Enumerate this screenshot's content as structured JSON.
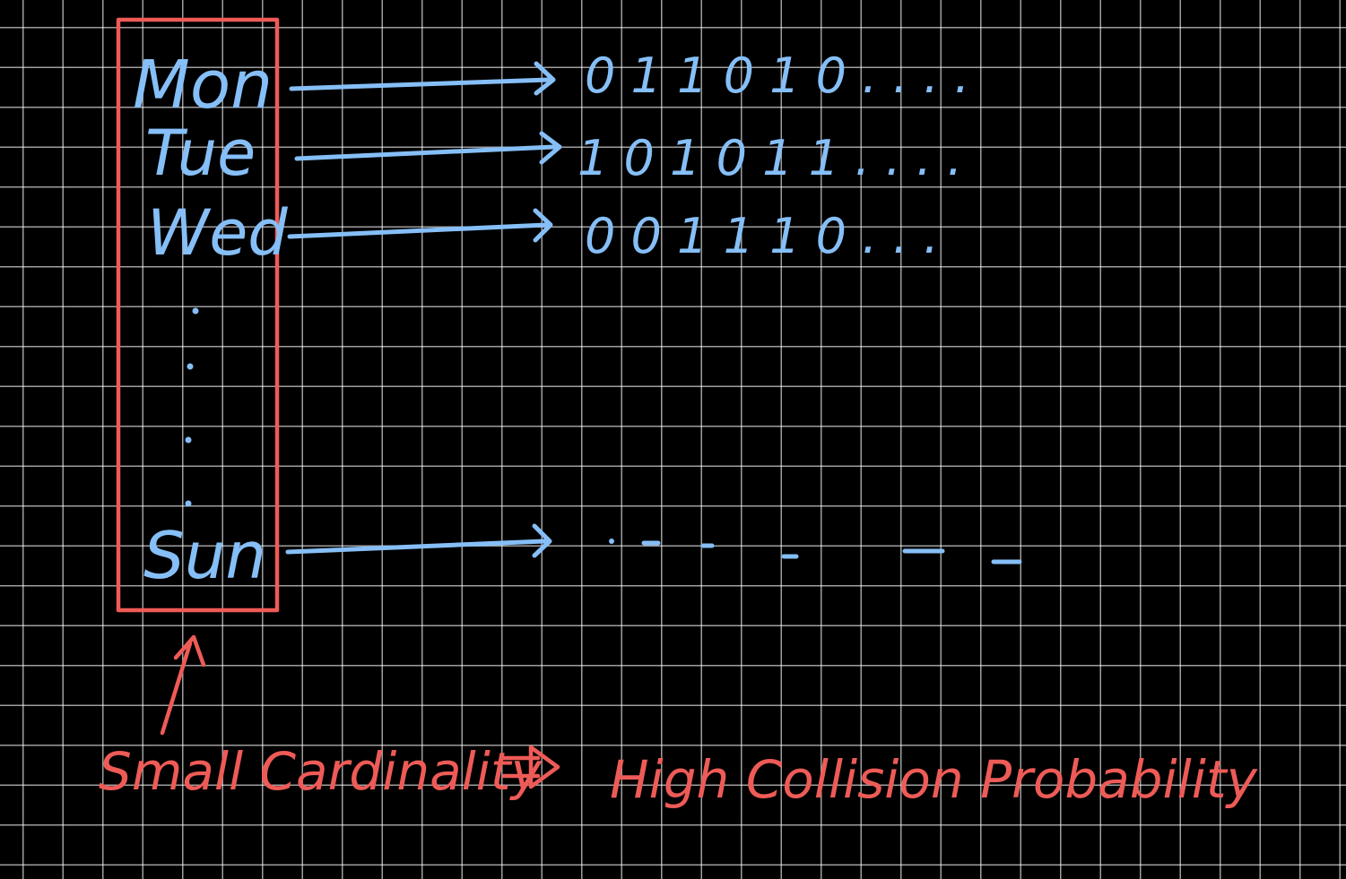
{
  "days": {
    "mon": "Mon",
    "tue": "Tue",
    "wed": "Wed",
    "sun": "Sun"
  },
  "sequences": {
    "mon": "0 1 1 0 1 0 . . . .",
    "tue": "1 0 1 0 1 1 . . . .",
    "wed": "0 0 1 1 1 0 . . .",
    "sun": ". . -  .   -     —   _"
  },
  "annotation": {
    "left": "Small Cardinality",
    "right": "High Collision Probability"
  },
  "colors": {
    "background": "#000000",
    "grid": "#9a9a9a",
    "blue": "#86bff7",
    "red": "#ee5b57"
  }
}
